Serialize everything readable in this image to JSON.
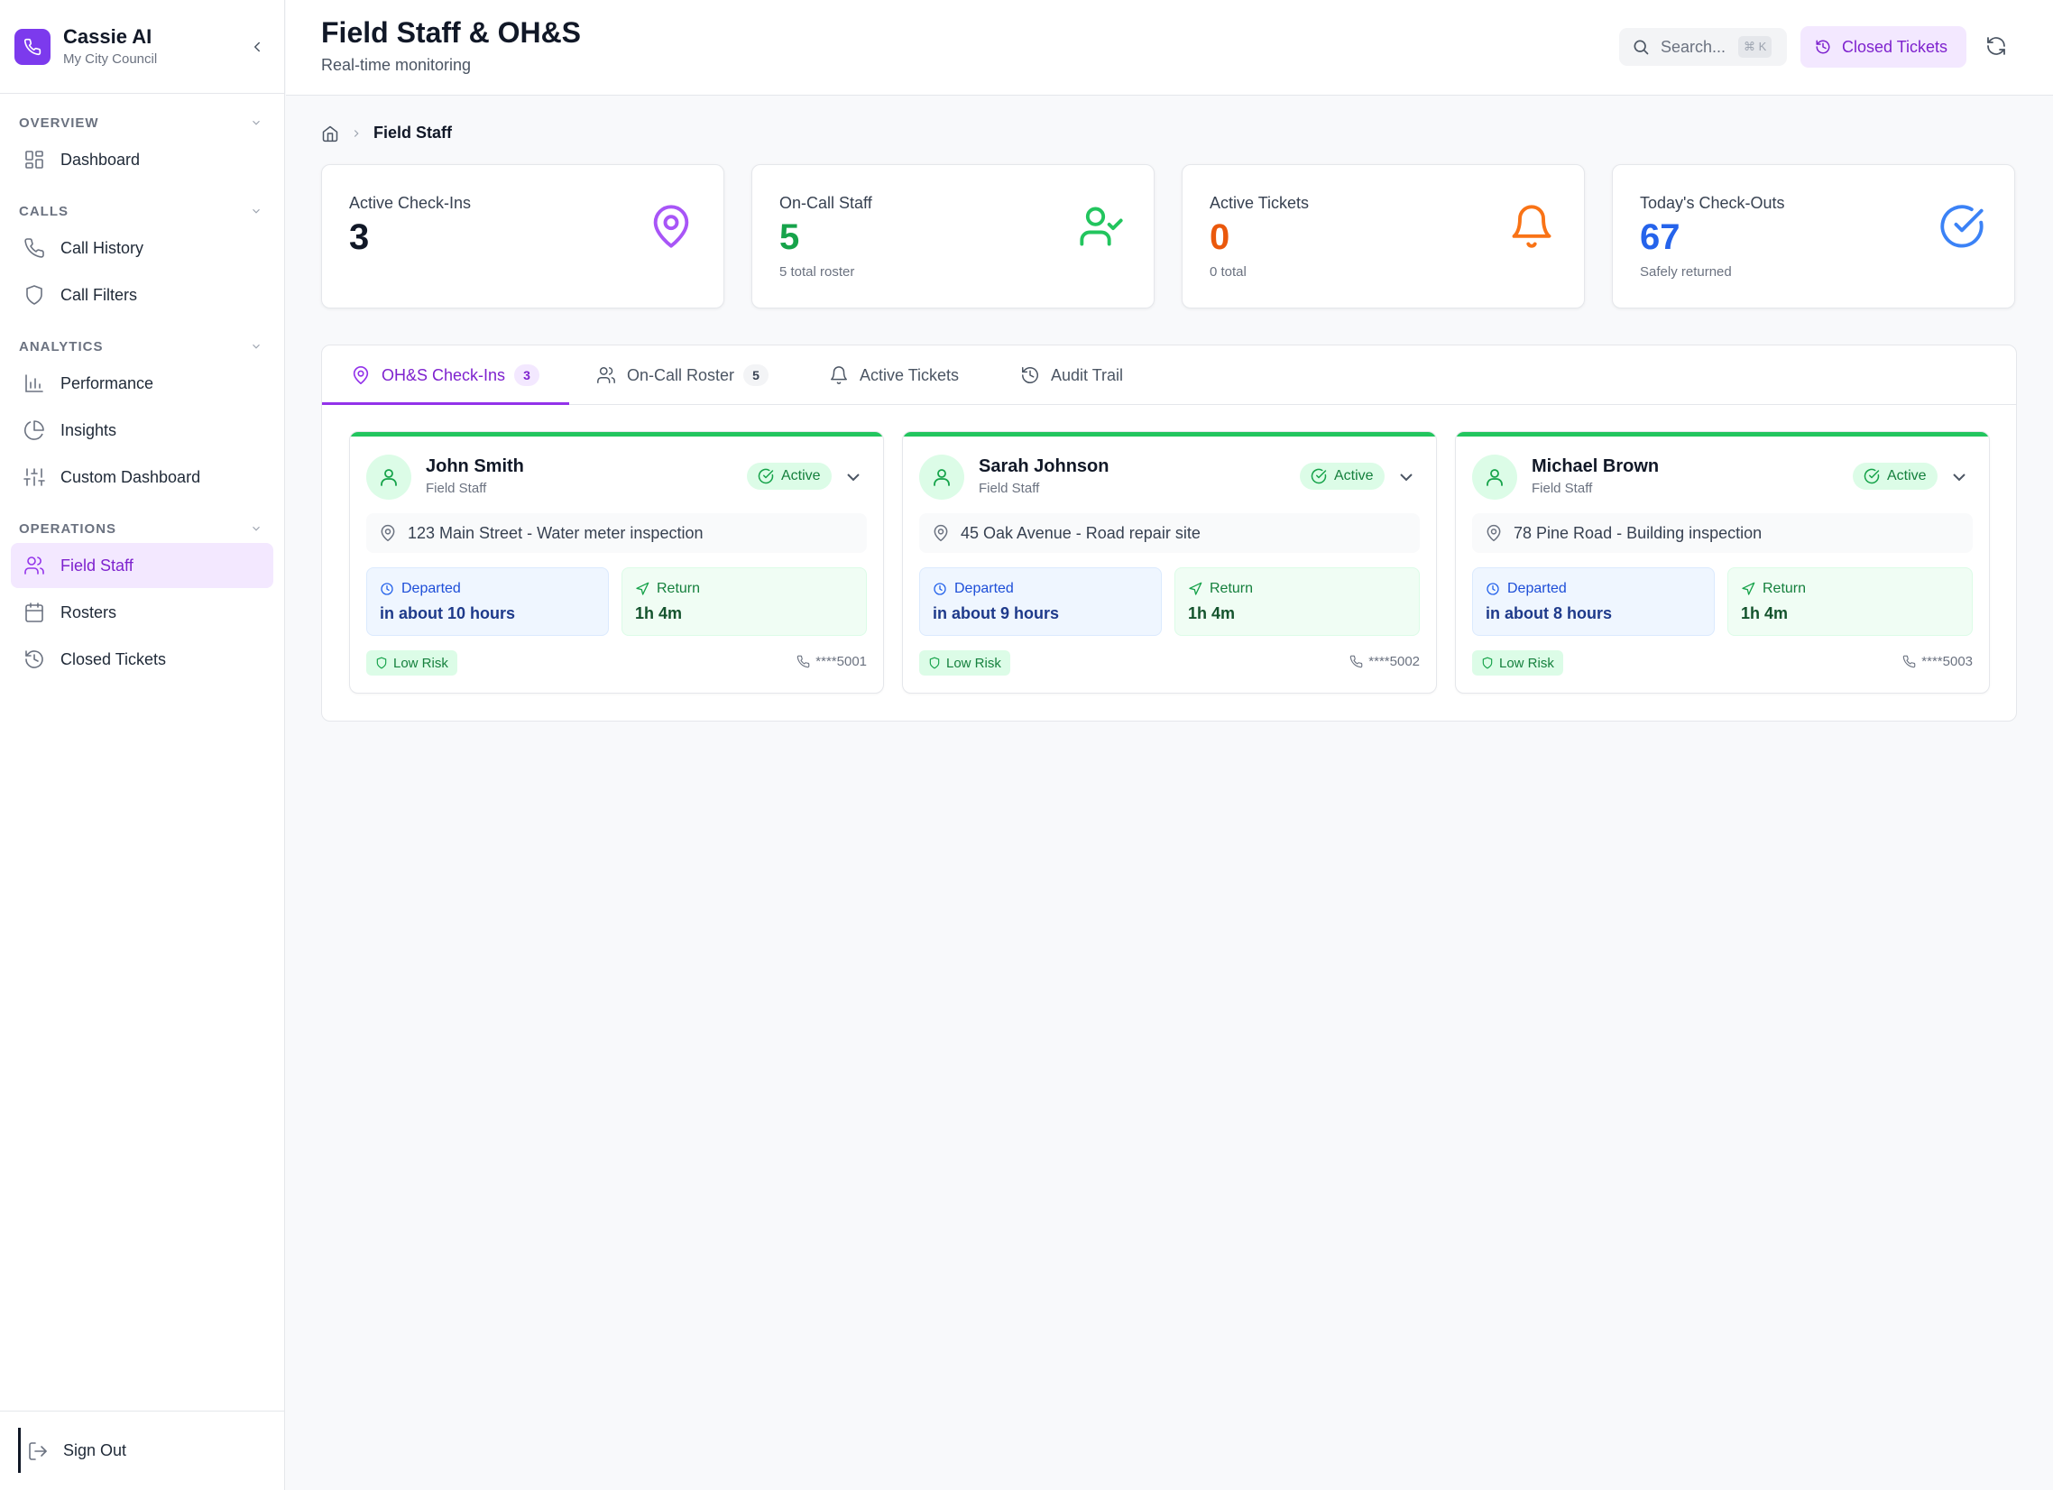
{
  "app": {
    "name": "Cassie AI",
    "org": "My City Council"
  },
  "sidebar": {
    "sections": [
      {
        "label": "OVERVIEW",
        "items": [
          {
            "label": "Dashboard",
            "icon": "dashboard-icon"
          }
        ]
      },
      {
        "label": "CALLS",
        "items": [
          {
            "label": "Call History",
            "icon": "phone-icon"
          },
          {
            "label": "Call Filters",
            "icon": "shield-icon"
          }
        ]
      },
      {
        "label": "ANALYTICS",
        "items": [
          {
            "label": "Performance",
            "icon": "bar-chart-icon"
          },
          {
            "label": "Insights",
            "icon": "pie-chart-icon"
          },
          {
            "label": "Custom Dashboard",
            "icon": "sliders-icon"
          }
        ]
      },
      {
        "label": "OPERATIONS",
        "items": [
          {
            "label": "Field Staff",
            "icon": "users-icon",
            "active": true
          },
          {
            "label": "Rosters",
            "icon": "calendar-icon"
          },
          {
            "label": "Closed Tickets",
            "icon": "history-icon"
          }
        ]
      }
    ],
    "sign_out": "Sign Out"
  },
  "header": {
    "title": "Field Staff & OH&S",
    "subtitle": "Real-time monitoring",
    "search_placeholder": "Search...",
    "search_shortcut": "⌘ K",
    "closed_tickets_label": "Closed Tickets"
  },
  "breadcrumb": {
    "current": "Field Staff"
  },
  "stats": [
    {
      "label": "Active Check-Ins",
      "value": "3",
      "sub": "",
      "color": "#111827",
      "icon": "map-pin-icon",
      "icon_color": "#a855f7"
    },
    {
      "label": "On-Call Staff",
      "value": "5",
      "sub": "5 total roster",
      "color": "#16a34a",
      "icon": "user-check-icon",
      "icon_color": "#22c55e"
    },
    {
      "label": "Active Tickets",
      "value": "0",
      "sub": "0 total",
      "color": "#ea580c",
      "icon": "bell-icon",
      "icon_color": "#f97316"
    },
    {
      "label": "Today's Check-Outs",
      "value": "67",
      "sub": "Safely returned",
      "color": "#2563eb",
      "icon": "check-circle-icon",
      "icon_color": "#3b82f6"
    }
  ],
  "tabs": [
    {
      "label": "OH&S Check-Ins",
      "count": "3",
      "active": true
    },
    {
      "label": "On-Call Roster",
      "count": "5"
    },
    {
      "label": "Active Tickets"
    },
    {
      "label": "Audit Trail"
    }
  ],
  "checkins": [
    {
      "name": "John Smith",
      "role": "Field Staff",
      "status": "Active",
      "location": "123 Main Street - Water meter inspection",
      "departed_label": "Departed",
      "departed": "in about 10 hours",
      "return_label": "Return",
      "return": "1h 4m",
      "risk": "Low Risk",
      "phone": "****5001"
    },
    {
      "name": "Sarah Johnson",
      "role": "Field Staff",
      "status": "Active",
      "location": "45 Oak Avenue - Road repair site",
      "departed_label": "Departed",
      "departed": "in about 9 hours",
      "return_label": "Return",
      "return": "1h 4m",
      "risk": "Low Risk",
      "phone": "****5002"
    },
    {
      "name": "Michael Brown",
      "role": "Field Staff",
      "status": "Active",
      "location": "78 Pine Road - Building inspection",
      "departed_label": "Departed",
      "departed": "in about 8 hours",
      "return_label": "Return",
      "return": "1h 4m",
      "risk": "Low Risk",
      "phone": "****5003"
    }
  ],
  "colors": {
    "accent": "#7c3aed",
    "active_bg": "#f3e8ff",
    "success": "#22c55e"
  }
}
